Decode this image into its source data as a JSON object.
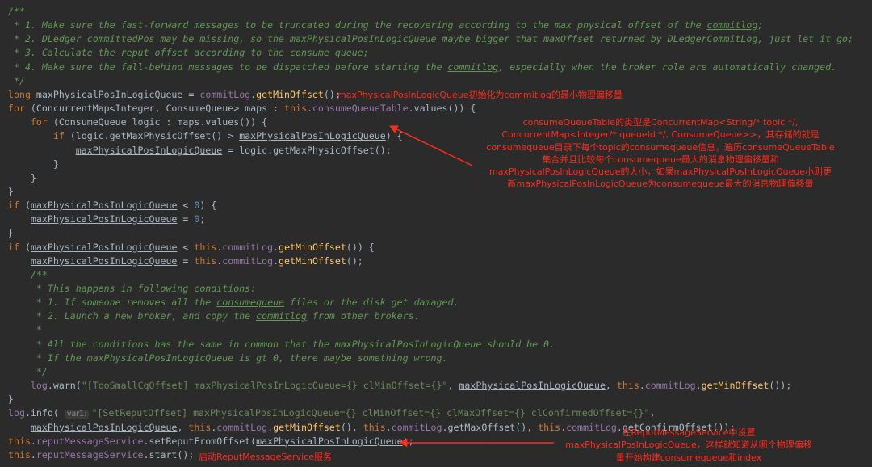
{
  "code_lines": [
    [
      {
        "t": "/**",
        "c": "doc"
      }
    ],
    [
      {
        "t": " * 1. Make sure the fast-forward messages to be truncated during the recovering according to the max physical offset of the ",
        "c": "doc"
      },
      {
        "t": "commitlog",
        "c": "docu"
      },
      {
        "t": ";",
        "c": "doc"
      }
    ],
    [
      {
        "t": " * 2. DLedger committedPos may be missing, so the maxPhysicalPosInLogicQueue maybe bigger that maxOffset returned by DLedgerCommitLog, just let it go;",
        "c": "doc"
      }
    ],
    [
      {
        "t": " * 3. Calculate the ",
        "c": "doc"
      },
      {
        "t": "reput",
        "c": "docu"
      },
      {
        "t": " offset according to the consume queue;",
        "c": "doc"
      }
    ],
    [
      {
        "t": " * 4. Make sure the fall-behind messages to be dispatched before starting the ",
        "c": "doc"
      },
      {
        "t": "commitlog",
        "c": "docu"
      },
      {
        "t": ", especially when the broker role are automatically changed.",
        "c": "doc"
      }
    ],
    [
      {
        "t": " */",
        "c": "doc"
      }
    ],
    [
      {
        "t": "long ",
        "c": "kw"
      },
      {
        "t": "maxPhysicalPosInLogicQueue",
        "c": "varu"
      },
      {
        "t": " = "
      },
      {
        "t": "commitLog",
        "c": "field"
      },
      {
        "t": "."
      },
      {
        "t": "getMinOffset",
        "c": "fn"
      },
      {
        "t": "();"
      }
    ],
    [
      {
        "t": "for ",
        "c": "kw"
      },
      {
        "t": "(ConcurrentMap<Integer, ConsumeQueue> maps : "
      },
      {
        "t": "this",
        "c": "kw"
      },
      {
        "t": "."
      },
      {
        "t": "consumeQueueTable",
        "c": "field"
      },
      {
        "t": ".values()) {"
      }
    ],
    [
      {
        "t": "    "
      },
      {
        "t": "for ",
        "c": "kw"
      },
      {
        "t": "(ConsumeQueue logic : maps.values()) {"
      }
    ],
    [
      {
        "t": "        "
      },
      {
        "t": "if ",
        "c": "kw"
      },
      {
        "t": "(logic.getMaxPhysicOffset() > "
      },
      {
        "t": "maxPhysicalPosInLogicQueue",
        "c": "varu"
      },
      {
        "t": ") {"
      }
    ],
    [
      {
        "t": "            "
      },
      {
        "t": "maxPhysicalPosInLogicQueue",
        "c": "varu"
      },
      {
        "t": " = logic.getMaxPhysicOffset();"
      }
    ],
    [
      {
        "t": "        }"
      }
    ],
    [
      {
        "t": "    }"
      }
    ],
    [
      {
        "t": "}"
      }
    ],
    [
      {
        "t": "if ",
        "c": "kw"
      },
      {
        "t": "("
      },
      {
        "t": "maxPhysicalPosInLogicQueue",
        "c": "varu"
      },
      {
        "t": " < "
      },
      {
        "t": "0",
        "c": "num"
      },
      {
        "t": ") {"
      }
    ],
    [
      {
        "t": "    "
      },
      {
        "t": "maxPhysicalPosInLogicQueue",
        "c": "varu"
      },
      {
        "t": " = "
      },
      {
        "t": "0",
        "c": "num"
      },
      {
        "t": ";"
      }
    ],
    [
      {
        "t": "}"
      }
    ],
    [
      {
        "t": "if ",
        "c": "kw"
      },
      {
        "t": "("
      },
      {
        "t": "maxPhysicalPosInLogicQueue",
        "c": "varu"
      },
      {
        "t": " < "
      },
      {
        "t": "this",
        "c": "kw"
      },
      {
        "t": "."
      },
      {
        "t": "commitLog",
        "c": "field"
      },
      {
        "t": "."
      },
      {
        "t": "getMinOffset",
        "c": "fn"
      },
      {
        "t": "()) {"
      }
    ],
    [
      {
        "t": "    "
      },
      {
        "t": "maxPhysicalPosInLogicQueue",
        "c": "varu"
      },
      {
        "t": " = "
      },
      {
        "t": "this",
        "c": "kw"
      },
      {
        "t": "."
      },
      {
        "t": "commitLog",
        "c": "field"
      },
      {
        "t": "."
      },
      {
        "t": "getMinOffset",
        "c": "fn"
      },
      {
        "t": "();"
      }
    ],
    [
      {
        "t": "    "
      },
      {
        "t": "/**",
        "c": "doc"
      }
    ],
    [
      {
        "t": "     * This happens in following conditions:",
        "c": "doc"
      }
    ],
    [
      {
        "t": "     * 1. If someone removes all the ",
        "c": "doc"
      },
      {
        "t": "consumequeue",
        "c": "docu"
      },
      {
        "t": " files or the disk get damaged.",
        "c": "doc"
      }
    ],
    [
      {
        "t": "     * 2. Launch a new broker, and copy the ",
        "c": "doc"
      },
      {
        "t": "commitlog",
        "c": "docu"
      },
      {
        "t": " from other brokers.",
        "c": "doc"
      }
    ],
    [
      {
        "t": "     *",
        "c": "doc"
      }
    ],
    [
      {
        "t": "     * All the conditions has the same in common that the maxPhysicalPosInLogicQueue should be 0.",
        "c": "doc"
      }
    ],
    [
      {
        "t": "     * If the maxPhysicalPosInLogicQueue is gt 0, there maybe something wrong.",
        "c": "doc"
      }
    ],
    [
      {
        "t": "     */",
        "c": "doc"
      }
    ],
    [
      {
        "t": "    "
      },
      {
        "t": "log",
        "c": "field"
      },
      {
        "t": ".warn("
      },
      {
        "t": "\"[TooSmallCqOffset] maxPhysicalPosInLogicQueue={} clMinOffset={}\"",
        "c": "str"
      },
      {
        "t": ", "
      },
      {
        "t": "maxPhysicalPosInLogicQueue",
        "c": "varu"
      },
      {
        "t": ", "
      },
      {
        "t": "this",
        "c": "kw"
      },
      {
        "t": "."
      },
      {
        "t": "commitLog",
        "c": "field"
      },
      {
        "t": "."
      },
      {
        "t": "getMinOffset",
        "c": "fn"
      },
      {
        "t": "());"
      }
    ],
    [
      {
        "t": "}"
      }
    ],
    [
      {
        "t": "log",
        "c": "field"
      },
      {
        "t": ".info( "
      },
      {
        "t": "var1:",
        "c": "hint"
      },
      {
        "t": "\"[SetReputOffset] maxPhysicalPosInLogicQueue={} clMinOffset={} clMaxOffset={} clConfirmedOffset={}\"",
        "c": "str"
      },
      {
        "t": ","
      }
    ],
    [
      {
        "t": "    "
      },
      {
        "t": "maxPhysicalPosInLogicQueue",
        "c": "varu"
      },
      {
        "t": ", "
      },
      {
        "t": "this",
        "c": "kw"
      },
      {
        "t": "."
      },
      {
        "t": "commitLog",
        "c": "field"
      },
      {
        "t": "."
      },
      {
        "t": "getMinOffset",
        "c": "fn"
      },
      {
        "t": "(), "
      },
      {
        "t": "this",
        "c": "kw"
      },
      {
        "t": "."
      },
      {
        "t": "commitLog",
        "c": "field"
      },
      {
        "t": ".getMaxOffset(), "
      },
      {
        "t": "this",
        "c": "kw"
      },
      {
        "t": "."
      },
      {
        "t": "commitLog",
        "c": "field"
      },
      {
        "t": ".getConfirmOffset());"
      }
    ],
    [
      {
        "t": "this",
        "c": "kw"
      },
      {
        "t": "."
      },
      {
        "t": "reputMessageService",
        "c": "field"
      },
      {
        "t": ".setReputFromOffset("
      },
      {
        "t": "maxPhysicalPosInLogicQueue",
        "c": "varu"
      },
      {
        "t": ");"
      }
    ],
    [
      {
        "t": "this",
        "c": "kw"
      },
      {
        "t": "."
      },
      {
        "t": "reputMessageService",
        "c": "field"
      },
      {
        "t": ".start();"
      }
    ]
  ],
  "annotations": {
    "init_note": "maxPhysicalPosInLogicQueue初始化为commitlog的最小物理偏移量",
    "table_note": [
      "consumeQueueTable的类型是ConcurrentMap<String/* topic */,",
      "ConcurrentMap<Integer/* queueId */, ConsumeQueue>>，其存储的就是",
      "consumequeue目录下每个topic的consumequeue信息，遍历consumeQueueTable",
      "集合并且比较每个consumequeue最大的消息物理偏移量和",
      "maxPhysicalPosInLogicQueue的大小，如果maxPhysicalPosInLogicQueue小则更",
      "新maxPhysicalPosInLogicQueue为consumequeue最大的消息物理偏移量"
    ],
    "reput_note": [
      "在ReputMessageService中设置",
      "maxPhysicalPosInLogicQueue，这样就知道从哪个物理偏移",
      "量开始构建consumequeue和index"
    ],
    "start_note": "启动ReputMessageService服务"
  },
  "colors": {
    "background": "#2b2b2b",
    "annotation": "#ff2b1c",
    "keyword": "#cc7832",
    "field": "#9876aa",
    "string": "#6a8759",
    "doc_comment": "#629755",
    "number": "#6897bb",
    "method": "#ffc66d"
  }
}
